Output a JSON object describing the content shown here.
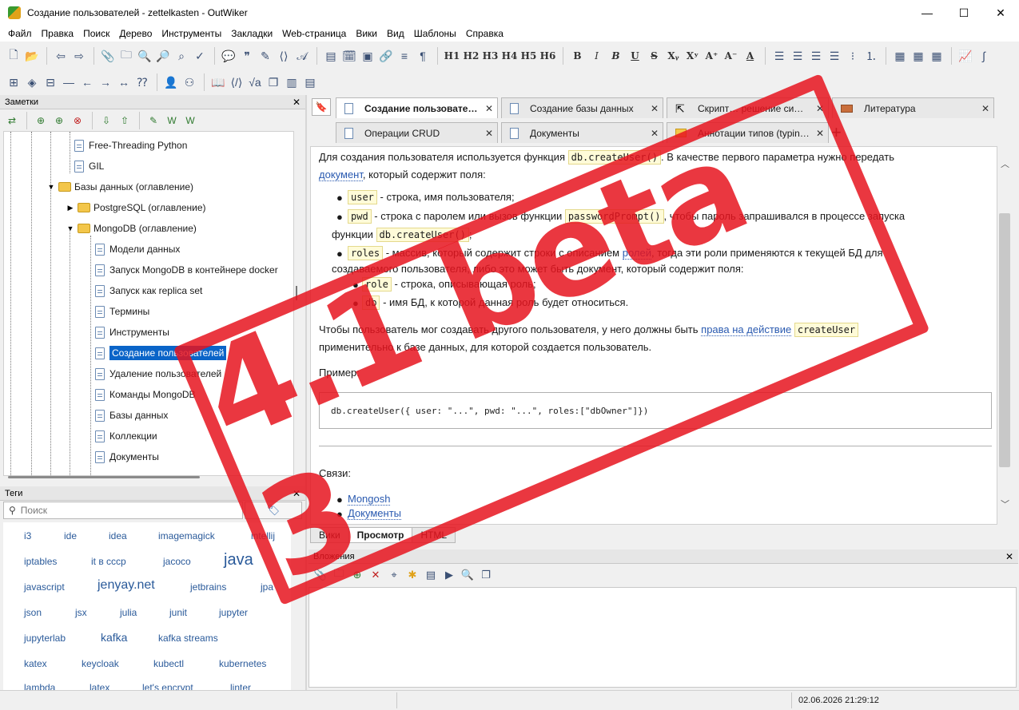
{
  "window": {
    "title": "Создание пользователей - zettelkasten - OutWiker",
    "minimize": "—",
    "maximize": "☐",
    "close": "✕"
  },
  "menu": [
    "Файл",
    "Правка",
    "Поиск",
    "Дерево",
    "Инструменты",
    "Закладки",
    "Web-страница",
    "Вики",
    "Вид",
    "Шаблоны",
    "Справка"
  ],
  "toolbar": {
    "headings": [
      "H1",
      "H2",
      "H3",
      "H4",
      "H5",
      "H6"
    ],
    "format": [
      "B",
      "I",
      "B",
      "U",
      "S",
      "Xᵧ",
      "Xʸ",
      "A⁺",
      "A⁻",
      "A"
    ]
  },
  "notes_panel": {
    "title": "Заметки",
    "tree": [
      {
        "label": "Free-Threading Python",
        "type": "page"
      },
      {
        "label": "GIL",
        "type": "page"
      },
      {
        "label": "Базы данных (оглавление)",
        "type": "folder"
      },
      {
        "label": "PostgreSQL (оглавление)",
        "type": "folder"
      },
      {
        "label": "MongoDB (оглавление)",
        "type": "folder"
      },
      {
        "label": "Модели данных",
        "type": "page"
      },
      {
        "label": "Запуск MongoDB в контейнере docker",
        "type": "page"
      },
      {
        "label": "Запуск как replica set",
        "type": "page"
      },
      {
        "label": "Термины",
        "type": "page"
      },
      {
        "label": "Инструменты",
        "type": "page"
      },
      {
        "label": "Создание пользователей",
        "type": "page"
      },
      {
        "label": "Удаление пользователей",
        "type": "page"
      },
      {
        "label": "Команды MongoDB",
        "type": "page"
      },
      {
        "label": "Базы данных",
        "type": "page"
      },
      {
        "label": "Коллекции",
        "type": "page"
      },
      {
        "label": "Документы",
        "type": "page"
      }
    ]
  },
  "tags_panel": {
    "title": "Теги",
    "search_placeholder": "Поиск",
    "tags": [
      "i3",
      "ide",
      "idea",
      "imagemagick",
      "intellij",
      "iptables",
      "it в ссср",
      "jacoco",
      "java",
      "javascript",
      "jenyay.net",
      "jetbrains",
      "jpa",
      "json",
      "jsx",
      "julia",
      "junit",
      "jupyter",
      "jupyterlab",
      "kafka",
      "kafka streams",
      "katex",
      "keycloak",
      "kubectl",
      "kubernetes",
      "lambda",
      "latex",
      "let's encrypt",
      "linter"
    ]
  },
  "tabs": [
    {
      "label": "Создание пользовате…",
      "active": true
    },
    {
      "label": "Создание базы данных"
    },
    {
      "label": "Скрипт… решение си…"
    },
    {
      "label": "Литература"
    },
    {
      "label": "Операции CRUD"
    },
    {
      "label": "Документы"
    },
    {
      "label": "Аннотации типов (typin…"
    }
  ],
  "content": {
    "p1a": "Для создания пользователя используется функция ",
    "p1_code": "db.createUser()",
    "p1b": ". В качестве первого параметра нужно передать ",
    "p1_link": "документ",
    "p1c": ", который содержит поля:",
    "li1_code": "user",
    "li1_text": " - строка, имя пользователя;",
    "li2_code": "pwd",
    "li2_text": " - строка с паролем или вызов функции ",
    "li2_code2": "passwordPrompt()",
    "li2_text2": ", чтобы пароль запрашивался в процессе запуска",
    "li2_text3": "функции ",
    "li2_code3": "db.createUser()",
    "li2_text4": ";",
    "li3_code": "roles",
    "li3_text": " - массив, который содержит строки с описанием ",
    "li3_link": "ролей",
    "li3_text2": ", тогда эти роли применяются к текущей БД для",
    "li3_text3": "создаваемого пользователя, либо это может быть документ, который содержит поля:",
    "li3a_code": "role",
    "li3a_text": " - строка, описывающая роль;",
    "li3b_code": "db",
    "li3b_text": " - имя БД, к которой данная роль будет относиться.",
    "p2a": "Чтобы пользователь мог создавать другого пользователя, у него должны быть ",
    "p2_link": "права на действие",
    "p2_code": "createUser",
    "p2b": "применительно к базе данных, для которой создается пользователь.",
    "example_label": "Пример:",
    "code_block": "db.createUser({ user: \"...\", pwd: \"...\", roles:[\"dbOwner\"]})",
    "links_label": "Связи:",
    "link1": "Mongosh",
    "link2": "Документы"
  },
  "mode_tabs": [
    "Вики",
    "Просмотр",
    "HTML"
  ],
  "attachments_panel": {
    "title": "Вложения"
  },
  "status": {
    "datetime": "02.06.2026 21:29:12"
  },
  "stamp": {
    "text": "4.1 beta 3",
    "color": "#e6141e"
  }
}
